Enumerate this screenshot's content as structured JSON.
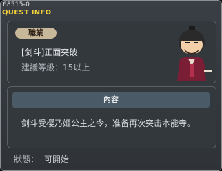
{
  "header": {
    "quest_id": "68515-0",
    "title": "QUEST INFO"
  },
  "info": {
    "job_badge": "職業",
    "quest_name": "[剑斗]正面突破",
    "required_level": "建議等級：15以上"
  },
  "npc": {
    "icon": "samurai-npc-portrait"
  },
  "description": {
    "header": "內容",
    "text": "剑斗受樱乃姬公主之令，准备再次突击本能寺。"
  },
  "status": {
    "label": "狀態：",
    "value": "可開始"
  },
  "colors": {
    "title": "#f1d13a",
    "badge": "#c8b89a",
    "desc_header": "#4a5a66"
  }
}
